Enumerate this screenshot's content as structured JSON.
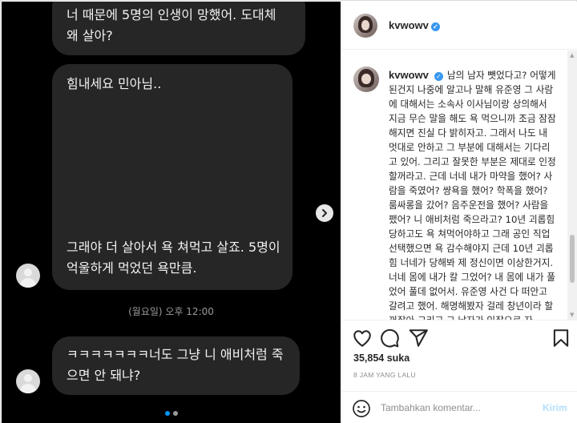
{
  "media": {
    "bubble1": "너 때문에 5명의 인생이 망했어. 도대체 왜 살아?",
    "bubble2_top": "힘내세요 민아님..",
    "bubble2_bottom": "그래야 더 살아서 욕 쳐먹고 살죠. 5명이 억울하게 먹었던 욕만큼.",
    "timestamp": "(월요일) 오후 12:00",
    "bubble3": "ㅋㅋㅋㅋㅋㅋㅋ너도 그냥 니 애비처럼 죽으면 안 돼냐?",
    "next_icon": "chevron-right-icon",
    "dots_total": 2,
    "dots_active_index": 0
  },
  "header": {
    "username": "kvwowv",
    "verified_icon": "verified-badge-icon"
  },
  "caption": {
    "username": "kvwowv",
    "text": "남의 남자 뺏었다고? 어떻게 된건지 나중에 알고나 말해 유준영 그 사람에 대해서는 소속사 이사님이랑 상의해서 지금 무슨 말을 해도 욕 먹으니까 조금 잠잠해지면 진실 다 밝히자고. 그래서 나도 내 멋대로 안하고 그 부분에 대해서는 기다리고 있어. 그리고 잘못한 부분은 제대로 인정할꺼라고. 근데 너네 내가 마약을 했어? 사람을 죽였어? 썅욕을 했어? 학폭을 했어? 룸싸롱을 갔어? 음주운전을 했어? 사람을 팼어? 니 애비처럼 죽으라고? 10년 괴롭힘 당하고도 욕 쳐먹어야하고 그래 공인 직업 선택했으면 욕 감수해야지 근데 10년 괴롭힘 너네가 당해봐 제 정신이면 이상한거지. 너네 몸에 내가 칼 그었어? 내 몸에 내가 풀었어 풀데 없어서. 유준영 사건 다 떠안고 갈려고 했어. 해명해봤자 걸레 창년이라 할꺼잖아 그리고 그 남자가 인잡으로 자"
  },
  "actions": {
    "like_icon": "heart-icon",
    "comment_icon": "comment-icon",
    "share_icon": "paper-plane-icon",
    "save_icon": "bookmark-icon",
    "likes": "35,854 suka",
    "time": "8 JAM YANG LALU"
  },
  "comment": {
    "placeholder": "Tambahkan komentar...",
    "post_label": "Kirim",
    "emoji_icon": "smiley-icon"
  },
  "colors": {
    "accent": "#0095f6",
    "verified": "#3897f0",
    "post_disabled": "#b2dffc",
    "bubble": "#262626"
  }
}
